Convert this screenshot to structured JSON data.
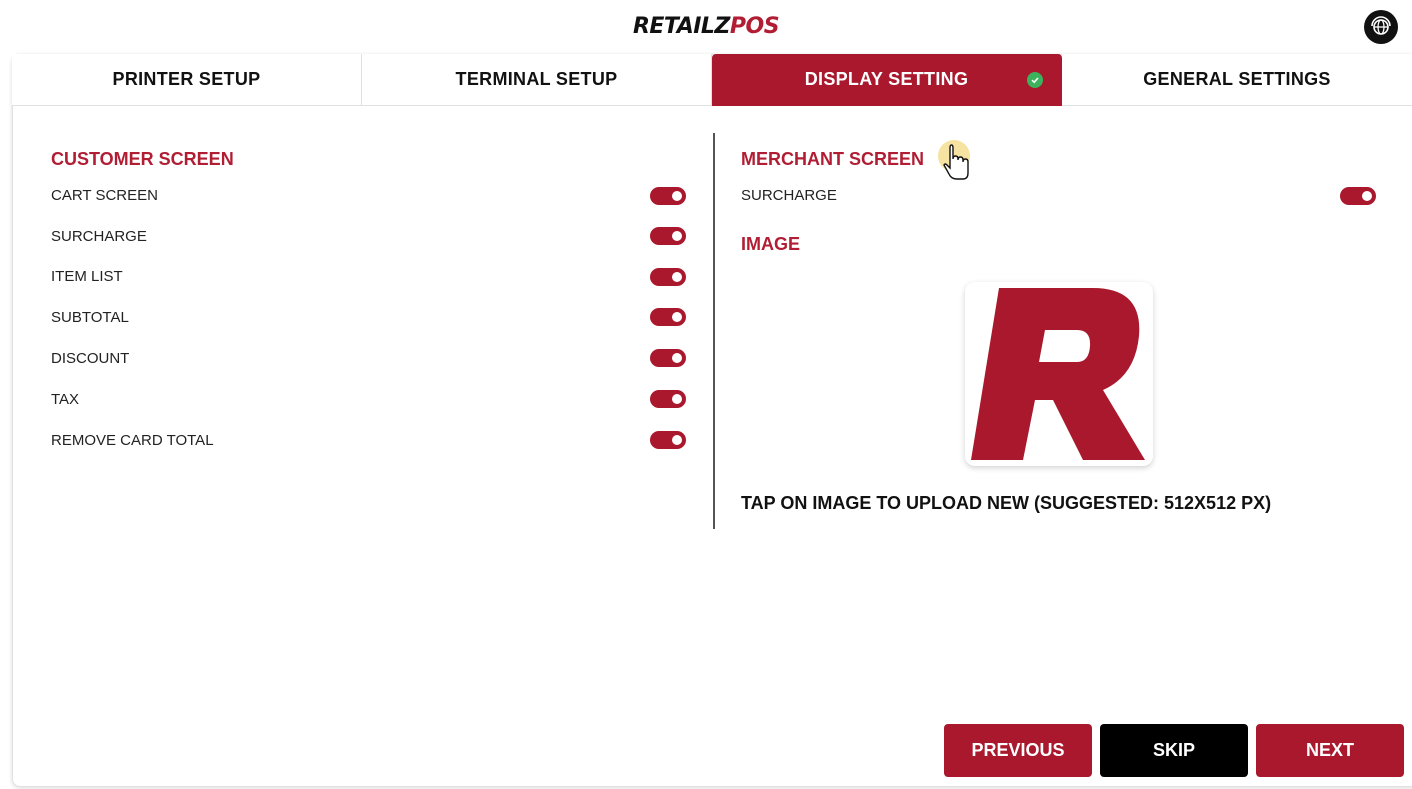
{
  "header": {
    "brand_part1": "RETAILZ",
    "brand_part2": "POS",
    "support_icon": "globe-headset-icon"
  },
  "tabs": [
    {
      "label": "PRINTER SETUP",
      "active": false
    },
    {
      "label": "TERMINAL SETUP",
      "active": false
    },
    {
      "label": "DISPLAY SETTING",
      "active": true,
      "completed": true
    },
    {
      "label": "GENERAL SETTINGS",
      "active": false
    }
  ],
  "customer_screen": {
    "title": "CUSTOMER SCREEN",
    "items": [
      {
        "label": "CART SCREEN",
        "enabled": true
      },
      {
        "label": "SURCHARGE",
        "enabled": true
      },
      {
        "label": "ITEM LIST",
        "enabled": true
      },
      {
        "label": "SUBTOTAL",
        "enabled": true
      },
      {
        "label": "DISCOUNT",
        "enabled": true
      },
      {
        "label": "TAX",
        "enabled": true
      },
      {
        "label": "REMOVE CARD TOTAL",
        "enabled": true
      }
    ]
  },
  "merchant_screen": {
    "title": "MERCHANT SCREEN",
    "items": [
      {
        "label": "SURCHARGE",
        "enabled": true
      }
    ]
  },
  "image_section": {
    "title": "IMAGE",
    "hint": "TAP ON IMAGE TO UPLOAD NEW (SUGGESTED: 512X512 PX)"
  },
  "footer": {
    "previous_label": "PREVIOUS",
    "skip_label": "SKIP",
    "next_label": "NEXT"
  },
  "colors": {
    "accent": "#a9182d",
    "brand_red": "#b11e34",
    "success": "#3db25c"
  }
}
